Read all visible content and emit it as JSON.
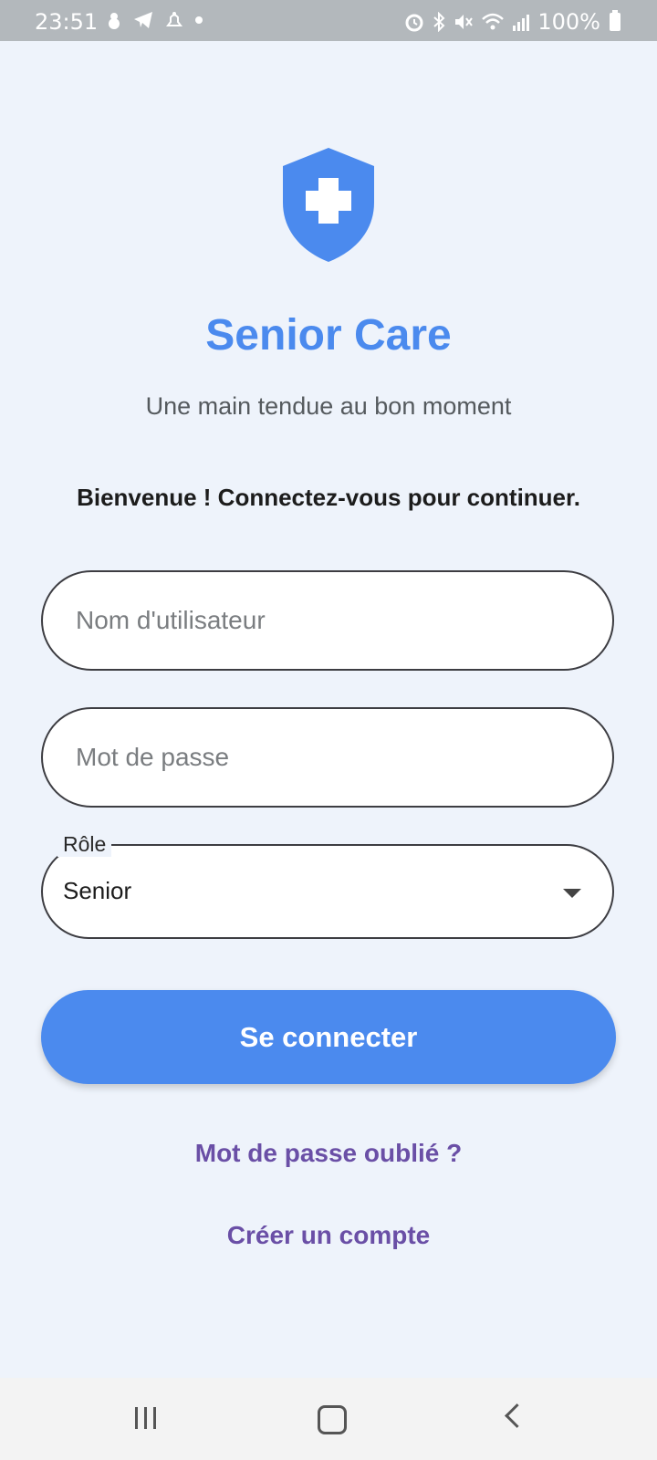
{
  "status_bar": {
    "time": "23:51",
    "battery": "100%",
    "left_icons": [
      "snowman-icon",
      "telegram-icon",
      "alarm-bell-icon",
      "dot-icon"
    ],
    "right_icons": [
      "alarm-clock-icon",
      "bluetooth-icon",
      "mute-icon",
      "wifi-icon",
      "signal-icon",
      "battery-icon"
    ]
  },
  "app": {
    "logo_icon": "shield-plus-icon",
    "title": "Senior Care",
    "tagline": "Une main tendue au bon moment",
    "welcome": "Bienvenue ! Connectez-vous pour continuer."
  },
  "form": {
    "username_placeholder": "Nom d'utilisateur",
    "password_placeholder": "Mot de passe",
    "role_label": "Rôle",
    "role_value": "Senior",
    "submit_label": "Se connecter"
  },
  "links": {
    "forgot_password": "Mot de passe oublié ?",
    "create_account": "Créer un compte"
  },
  "colors": {
    "accent": "#4b8aee",
    "link": "#6a4fa6",
    "background": "#eef3fb"
  },
  "nav_bar": {
    "icons": [
      "recents-icon",
      "home-icon",
      "back-icon"
    ]
  }
}
